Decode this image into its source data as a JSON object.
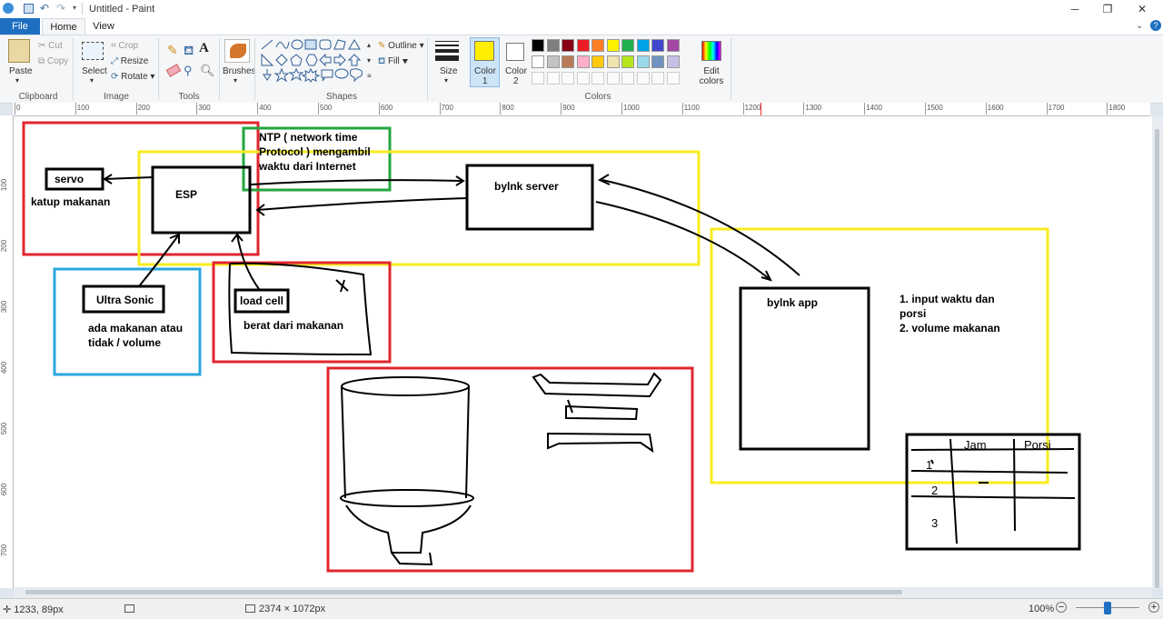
{
  "window": {
    "title": "Untitled - Paint"
  },
  "tabs": [
    {
      "label": "File"
    },
    {
      "label": "Home"
    },
    {
      "label": "View"
    }
  ],
  "ribbon": {
    "clipboard": {
      "paste": "Paste",
      "cut": "Cut",
      "copy": "Copy",
      "group": "Clipboard"
    },
    "image": {
      "select": "Select",
      "crop": "Crop",
      "resize": "Resize",
      "rotate": "Rotate",
      "group": "Image"
    },
    "tools": {
      "group": "Tools"
    },
    "brushes": {
      "label": "Brushes"
    },
    "shapes": {
      "outline": "Outline",
      "fill": "Fill",
      "group": "Shapes"
    },
    "size": {
      "label": "Size"
    },
    "color1": {
      "label": "Color",
      "sub": "1",
      "value": "#ffee00"
    },
    "color2": {
      "label": "Color",
      "sub": "2",
      "value": "#ffffff"
    },
    "colors": {
      "group": "Colors",
      "edit": "Edit colors"
    },
    "palette": [
      "#000000",
      "#7f7f7f",
      "#880015",
      "#ed1c24",
      "#ff7f27",
      "#fff200",
      "#22b14c",
      "#00a2e8",
      "#3f48cc",
      "#a349a4",
      "#ffffff",
      "#c3c3c3",
      "#b97a57",
      "#ffaec9",
      "#ffc90e",
      "#efe4b0",
      "#b5e61d",
      "#99d9ea",
      "#7092be",
      "#c8bfe7"
    ]
  },
  "ruler": {
    "ticks": [
      "0",
      "100",
      "200",
      "300",
      "400",
      "500",
      "600",
      "700",
      "800",
      "900",
      "1000",
      "1100",
      "1200",
      "1300",
      "1400",
      "1500",
      "1600",
      "1700",
      "1800"
    ],
    "vticks": [
      "100",
      "200",
      "300",
      "400",
      "500",
      "600",
      "700"
    ]
  },
  "drawing": {
    "servo": "servo",
    "katup": "katup makanan",
    "esp": "ESP",
    "ntp1": "NTP ( network time",
    "ntp2": "Protocol ) mengambil",
    "ntp3": "waktu dari Internet",
    "server": "bylnk server",
    "ultra": "Ultra Sonic",
    "ultra_desc1": "ada makanan atau",
    "ultra_desc2": "tidak / volume",
    "loadcell": "load cell",
    "loadcell_desc": "berat dari makanan",
    "app": "bylnk app",
    "app_note1": "1. input waktu dan",
    "app_note2": "porsi",
    "app_note3": "2. volume makanan",
    "table_h1": "Jam",
    "table_h2": "Porsi",
    "table_r1": "1",
    "table_r2": "2",
    "table_r3": "3"
  },
  "status": {
    "cursor": "1233, 89px",
    "size": "2374 × 1072px",
    "zoom": "100%"
  }
}
